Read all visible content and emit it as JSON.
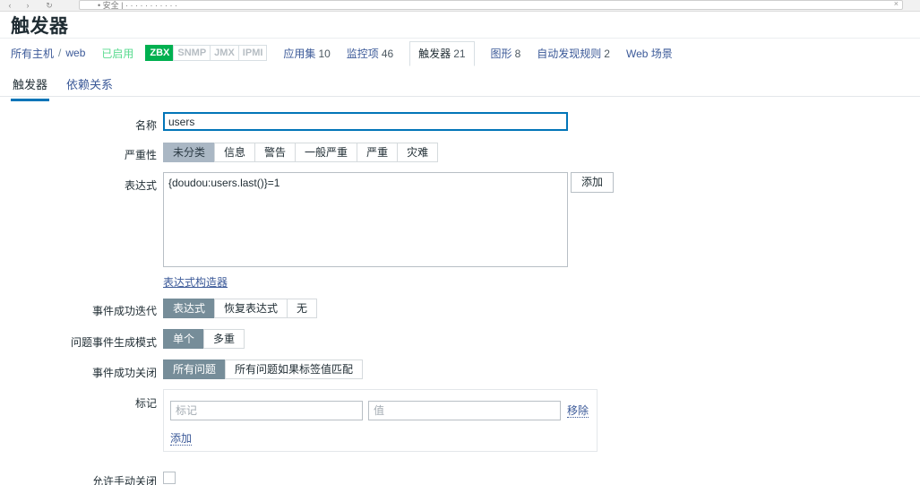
{
  "browser": {
    "back_icon": "back-arrow-icon",
    "forward_icon": "forward-arrow-icon",
    "reload_icon": "reload-icon",
    "url_text": "• 安全 | · · · · · · · · · · ·",
    "close_icon": "×"
  },
  "header": {
    "title": "触发器"
  },
  "breadcrumb": {
    "all_hosts": "所有主机",
    "separator": "/",
    "host": "web",
    "status": "已启用",
    "badges": [
      {
        "label": "ZBX",
        "active": true
      },
      {
        "label": "SNMP",
        "active": false
      },
      {
        "label": "JMX",
        "active": false
      },
      {
        "label": "IPMI",
        "active": false
      }
    ],
    "nav": [
      {
        "label": "应用集",
        "count": "10",
        "selected": false
      },
      {
        "label": "监控项",
        "count": "46",
        "selected": false
      },
      {
        "label": "触发器",
        "count": "21",
        "selected": true
      },
      {
        "label": "图形",
        "count": "8",
        "selected": false
      },
      {
        "label": "自动发现规则",
        "count": "2",
        "selected": false
      },
      {
        "label": "Web 场景",
        "count": "",
        "selected": false
      }
    ]
  },
  "tabs": [
    {
      "label": "触发器",
      "active": true
    },
    {
      "label": "依赖关系",
      "active": false
    }
  ],
  "form": {
    "name": {
      "label": "名称",
      "value": "users",
      "placeholder": ""
    },
    "severity": {
      "label": "严重性",
      "options": [
        "未分类",
        "信息",
        "警告",
        "一般严重",
        "严重",
        "灾难"
      ],
      "selected_index": 0
    },
    "expression": {
      "label": "表达式",
      "value": "{doudou:users.last()}=1",
      "add_button": "添加",
      "constructor_link": "表达式构造器"
    },
    "ok_event_generation": {
      "label": "事件成功迭代",
      "options": [
        "表达式",
        "恢复表达式",
        "无"
      ],
      "selected_index": 0
    },
    "problem_event_generation_mode": {
      "label": "问题事件生成模式",
      "options": [
        "单个",
        "多重"
      ],
      "selected_index": 0
    },
    "ok_event_closes": {
      "label": "事件成功关闭",
      "options": [
        "所有问题",
        "所有问题如果标签值匹配"
      ],
      "selected_index": 0
    },
    "tags": {
      "label": "标记",
      "rows": [
        {
          "tag_value": "",
          "tag_placeholder": "标记",
          "value_value": "",
          "value_placeholder": "值",
          "remove_label": "移除"
        }
      ],
      "add_label": "添加"
    },
    "allow_manual_close": {
      "label": "允许手动关闭",
      "checked": false
    }
  },
  "colors": {
    "accent_blue": "#0275b8",
    "link_blue": "#3b5998",
    "status_green": "#59db8f",
    "badge_green": "#00b050",
    "seg_selected_light": "#aab7c4",
    "seg_selected_dark": "#768d99"
  }
}
